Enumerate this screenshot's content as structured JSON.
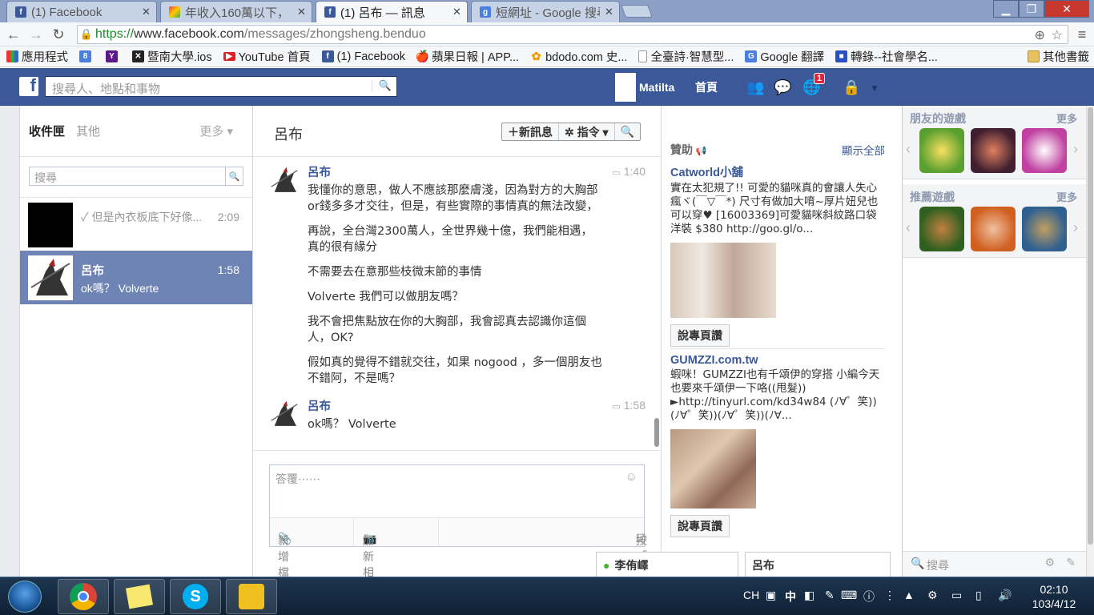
{
  "browser": {
    "tabs": [
      {
        "title": "(1) Facebook",
        "icon": "facebook-icon",
        "active": false
      },
      {
        "title": "年收入160萬以下，",
        "icon": "colorful-icon",
        "active": false
      },
      {
        "title": "(1) 呂布 — 訊息",
        "icon": "facebook-icon",
        "active": true
      },
      {
        "title": "短網址 - Google 搜尋",
        "icon": "google-icon",
        "active": false
      }
    ],
    "url_protocol": "https://",
    "url_host": "www.facebook.com",
    "url_path": "/messages/zhongsheng.benduo",
    "bookmarks": [
      {
        "label": "應用程式",
        "icon": "apps-grid-icon"
      },
      {
        "label": "",
        "icon": "google-plus-icon"
      },
      {
        "label": "",
        "icon": "yahoo-icon"
      },
      {
        "label": "暨南大學.ios",
        "icon": "puzzle-icon"
      },
      {
        "label": "YouTube 首頁",
        "icon": "youtube-icon"
      },
      {
        "label": "(1) Facebook",
        "icon": "facebook-icon"
      },
      {
        "label": "蘋果日報 | APP...",
        "icon": "apple-daily-icon"
      },
      {
        "label": "bdodo.com 史...",
        "icon": "flower-icon"
      },
      {
        "label": "全臺詩·智慧型...",
        "icon": "page-icon"
      },
      {
        "label": "Google 翻譯",
        "icon": "translate-icon"
      },
      {
        "label": "轉錄--社會學名...",
        "icon": "chat-bubble-icon"
      },
      {
        "label": "其他書籤",
        "icon": "folder-icon"
      }
    ]
  },
  "fb": {
    "search_placeholder": "搜尋人、地點和事物",
    "username": "Matilta",
    "home": "首頁",
    "notification_count": "1"
  },
  "inbox": {
    "tab_inbox": "收件匣",
    "tab_other": "其他",
    "more": "更多 ▾",
    "search_placeholder": "搜尋",
    "threads": [
      {
        "name": "",
        "snippet": "✓ 但是內衣板底下好像...",
        "time": "2:09"
      },
      {
        "name": "呂布",
        "snippet": "ok嗎？ Volverte",
        "time": "1:58"
      }
    ]
  },
  "conversation": {
    "title": "呂布",
    "new_message": "＋新訊息",
    "actions": "✲ 指令 ▾",
    "messages": [
      {
        "sender": "呂布",
        "time": "1:40",
        "lines": [
          "我懂你的意思，做人不應該那麼膚淺，因為對方的大胸部",
          "or錢多多才交往，但是，有些實際的事情真的無法改變，",
          "再說，全台灣2300萬人，全世界幾十億，我們能相遇，",
          "真的很有緣分",
          "不需要去在意那些枝微末節的事情",
          "Volverte  我們可以做朋友嗎？",
          "我不會把焦點放在你的大胸部，我會認真去認識你這個",
          "人，OK?",
          "假如真的覺得不錯就交往，如果 nogood ，多一個朋友也",
          "不錯阿，不是嗎？"
        ]
      },
      {
        "sender": "呂布",
        "time": "1:58",
        "lines": [
          "ok嗎？ Volverte"
        ]
      }
    ],
    "reply_placeholder": "答覆⋯⋯",
    "add_file": "新增檔案",
    "add_photo": "加新相片",
    "enter_send": "按「Enter」直接傳送"
  },
  "ads": {
    "header": "贊助",
    "show_all": "顯示全部",
    "items": [
      {
        "title": "Catworld小舖",
        "body": "實在太犯規了!! 可愛的貓咪真的會讓人失心瘋ヾ(￣▽￣*) 尺寸有做加大唷~厚片妞兒也可以穿♥ [16003369]可愛貓咪斜紋路口袋洋裝 $380 http://goo.gl/o...",
        "like": "說專頁讚"
      },
      {
        "title": "GUMZZI.com.tw",
        "body": "蝦咪！GUMZZI也有千頌伊的穿搭 小編今天也要來千頌伊一下咯((甩髮)) ►http://tinyurl.com/kd34w84 (ﾉ∀゜笑))(ﾉ∀゜笑))(ﾉ∀゜笑))(ﾉ∀...",
        "like": "說專頁讚"
      }
    ]
  },
  "sidebar": {
    "friends_games": "朋友的遊戲",
    "recommended_games": "推薦遊戲",
    "more": "更多",
    "search_placeholder": "搜尋"
  },
  "chat_tabs": [
    {
      "name": "李侑嶧",
      "online": true
    },
    {
      "name": "呂布",
      "online": false
    }
  ],
  "taskbar": {
    "lang": "CH",
    "ime": "中",
    "time": "02:10",
    "date": "103/4/12"
  }
}
